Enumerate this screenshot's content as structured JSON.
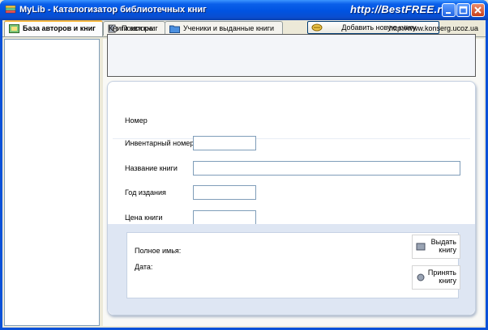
{
  "window": {
    "title": "MyLib - Каталогизатор библиотечных книг",
    "watermark": "http://BestFREE.ru",
    "controls": [
      "minimize",
      "maximize",
      "close"
    ]
  },
  "tabs": [
    {
      "label": "База авторов и книг",
      "icon": "database-icon",
      "active": true
    },
    {
      "label": "Поиск книг",
      "icon": "book-search-icon",
      "active": false
    },
    {
      "label": "Ученики и выданные книги",
      "icon": "folder-icon",
      "active": false
    }
  ],
  "toolbar": {
    "add_book_label": "Добавить новую книгу",
    "add_book_icon": "book-add-icon"
  },
  "author_books": {
    "label": "Книги автора:",
    "url": "http://www.konserg.ucoz.ua"
  },
  "form": {
    "number_label": "Номер",
    "inventory_label": "Инвентарный номер",
    "inventory_value": "",
    "title_label": "Название книги",
    "title_value": "",
    "year_label": "Год издания",
    "year_value": "",
    "price_label": "Цена книги",
    "price_value": ""
  },
  "loan": {
    "full_name_label": "Полное имья:",
    "date_label": "Дата:",
    "issue_button": "Выдать книгу",
    "return_button": "Принять книгу"
  },
  "colors": {
    "titlebar": "#0A5FEA",
    "accent": "#F7B73D",
    "panel_blue": "#DEE6F3"
  }
}
